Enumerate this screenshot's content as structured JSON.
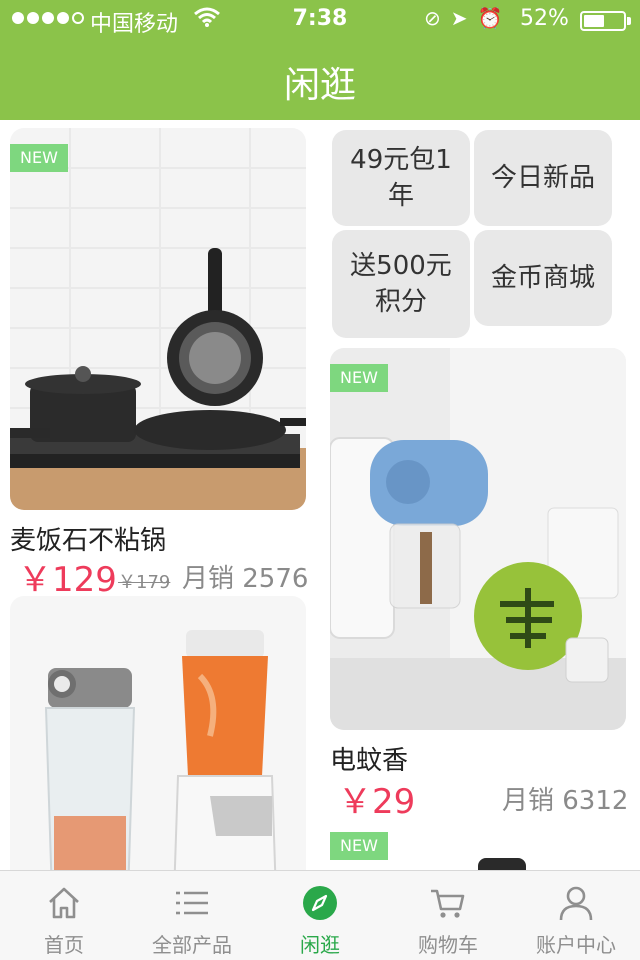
{
  "status_bar": {
    "carrier": "中国移动",
    "time": "7:38",
    "battery_percent": "52%",
    "battery_level": 0.52
  },
  "nav": {
    "title": "闲逛"
  },
  "products": [
    {
      "badge": "NEW",
      "title": "麦饭石不粘锅",
      "price": "￥129",
      "old_price": "￥179",
      "sales": "月销 2576",
      "image_icon": "cookware-photo"
    },
    {
      "badge": "NEW",
      "title": "电蚊香",
      "price": "￥29",
      "sales": "月销 6312",
      "image_icon": "mosquito-repeller-photo"
    },
    {
      "image_icon": "juicer-photo"
    },
    {
      "badge": "NEW",
      "image_icon": "product-photo"
    }
  ],
  "promo_tiles": [
    {
      "label": "49元包1年"
    },
    {
      "label": "今日新品"
    },
    {
      "label": "送500元积分"
    },
    {
      "label": "金币商城"
    }
  ],
  "tabs": [
    {
      "label": "首页",
      "icon": "home-icon"
    },
    {
      "label": "全部产品",
      "icon": "list-icon"
    },
    {
      "label": "闲逛",
      "icon": "compass-icon",
      "active": true
    },
    {
      "label": "购物车",
      "icon": "cart-icon"
    },
    {
      "label": "账户中心",
      "icon": "user-icon"
    }
  ],
  "colors": {
    "brand_green": "#8bc34a",
    "badge_green": "#7ed77f",
    "price_red": "#ee3b5b",
    "active_tab": "#2aa84a"
  }
}
